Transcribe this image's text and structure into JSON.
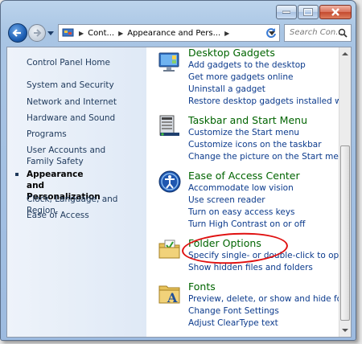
{
  "addressbar": {
    "crumbs": [
      "Cont...",
      "Appearance and Pers...",
      ""
    ],
    "search_placeholder": "Search Con..."
  },
  "sidebar": {
    "items": [
      {
        "label": "Control Panel Home"
      },
      {
        "label": "System and Security"
      },
      {
        "label": "Network and Internet"
      },
      {
        "label": "Hardware and Sound"
      },
      {
        "label": "Programs"
      },
      {
        "label": "User Accounts and Family Safety"
      },
      {
        "label": "Appearance and Personalization"
      },
      {
        "label": "Clock, Language, and Region"
      },
      {
        "label": "Ease of Access"
      }
    ]
  },
  "categories": [
    {
      "title": "Desktop Gadgets",
      "icon": "gadgets-icon",
      "links": [
        "Add gadgets to the desktop",
        "Get more gadgets online",
        "Uninstall a gadget",
        "Restore desktop gadgets installed with"
      ]
    },
    {
      "title": "Taskbar and Start Menu",
      "icon": "taskbar-icon",
      "links": [
        "Customize the Start menu",
        "Customize icons on the taskbar",
        "Change the picture on the Start menu"
      ]
    },
    {
      "title": "Ease of Access Center",
      "icon": "ease-of-access-icon",
      "links": [
        "Accommodate low vision",
        "Use screen reader",
        "Turn on easy access keys",
        "Turn High Contrast on or off"
      ]
    },
    {
      "title": "Folder Options",
      "icon": "folder-options-icon",
      "links": [
        "Specify single- or double-click to open",
        "Show hidden files and folders"
      ]
    },
    {
      "title": "Fonts",
      "icon": "fonts-icon",
      "links": [
        "Preview, delete, or show and hide fonts",
        "Change Font Settings",
        "Adjust ClearType text"
      ]
    }
  ],
  "colors": {
    "category_title": "#006400",
    "link": "#0b3a8c",
    "sidebar_text": "#1e395b",
    "annotation_circle": "#e01010"
  }
}
